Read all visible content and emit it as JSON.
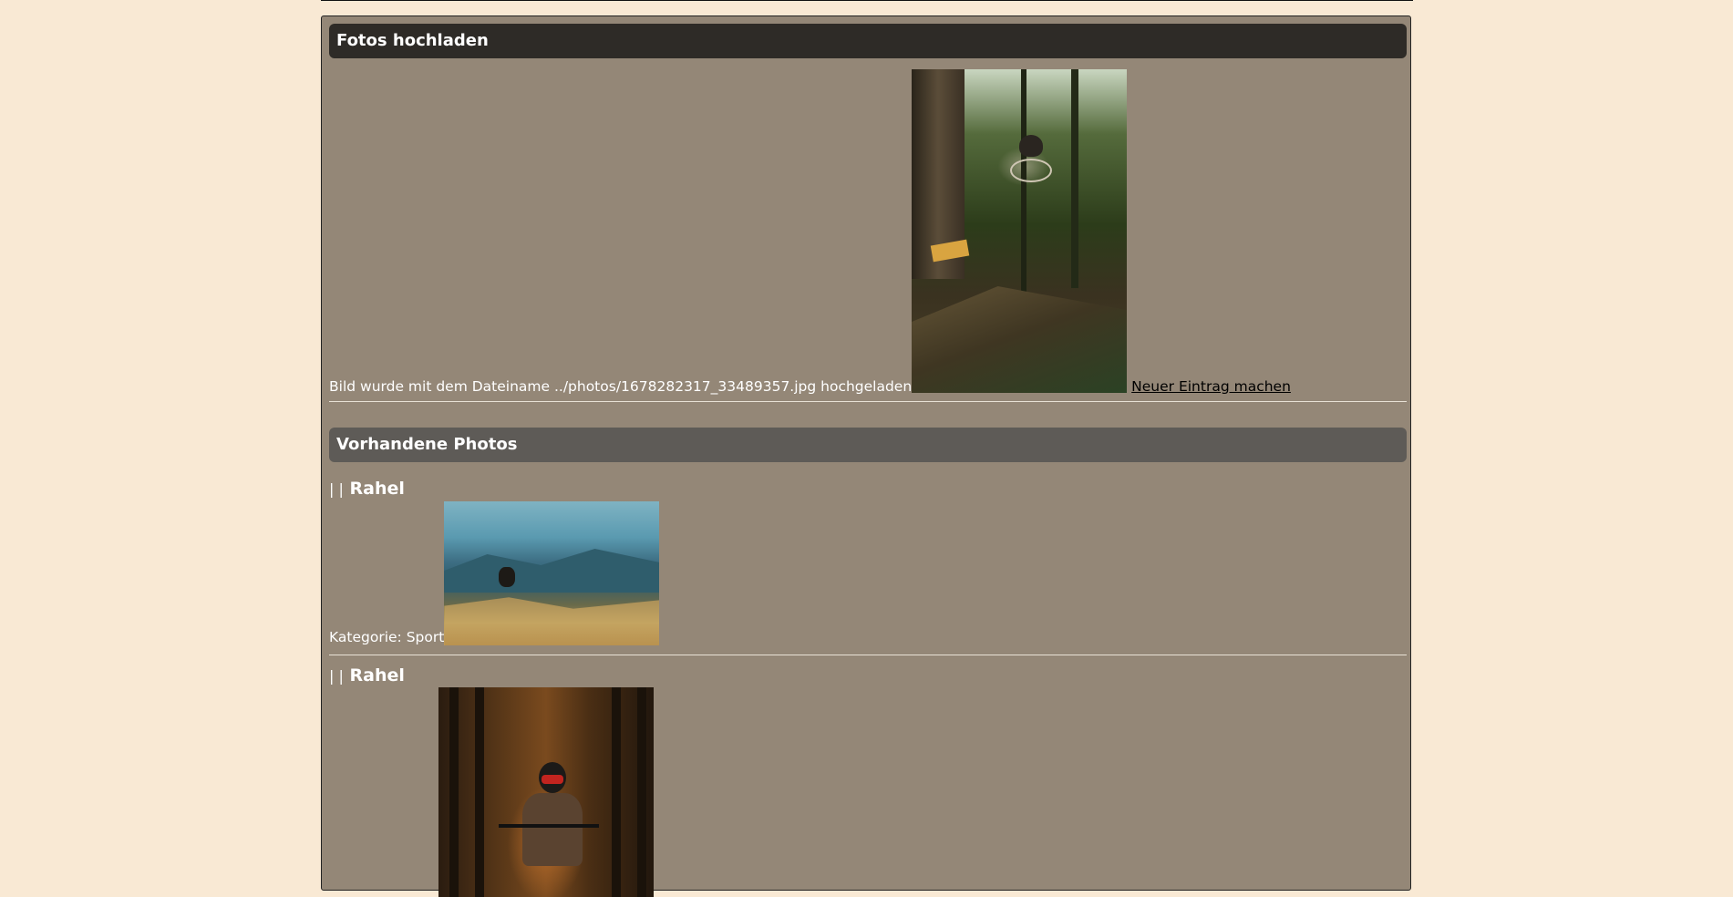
{
  "upload_section": {
    "title": "Fotos hochladen",
    "message": "Bild wurde mit dem Dateiname ../photos/1678282317_33489357.jpg hochgeladen",
    "new_entry_link": "Neuer Eintrag machen"
  },
  "existing_section": {
    "title": "Vorhandene Photos",
    "entries": [
      {
        "pipes": "| |",
        "author": "Rahel",
        "category_text": "Kategorie: Sport"
      },
      {
        "pipes": "| |",
        "author": "Rahel"
      }
    ]
  },
  "colors": {
    "page_background": "#f9e9d4",
    "panel_background": "#948777",
    "upload_header": "#2e2b27",
    "existing_header": "#5e5b57",
    "text": "#ffffff"
  }
}
